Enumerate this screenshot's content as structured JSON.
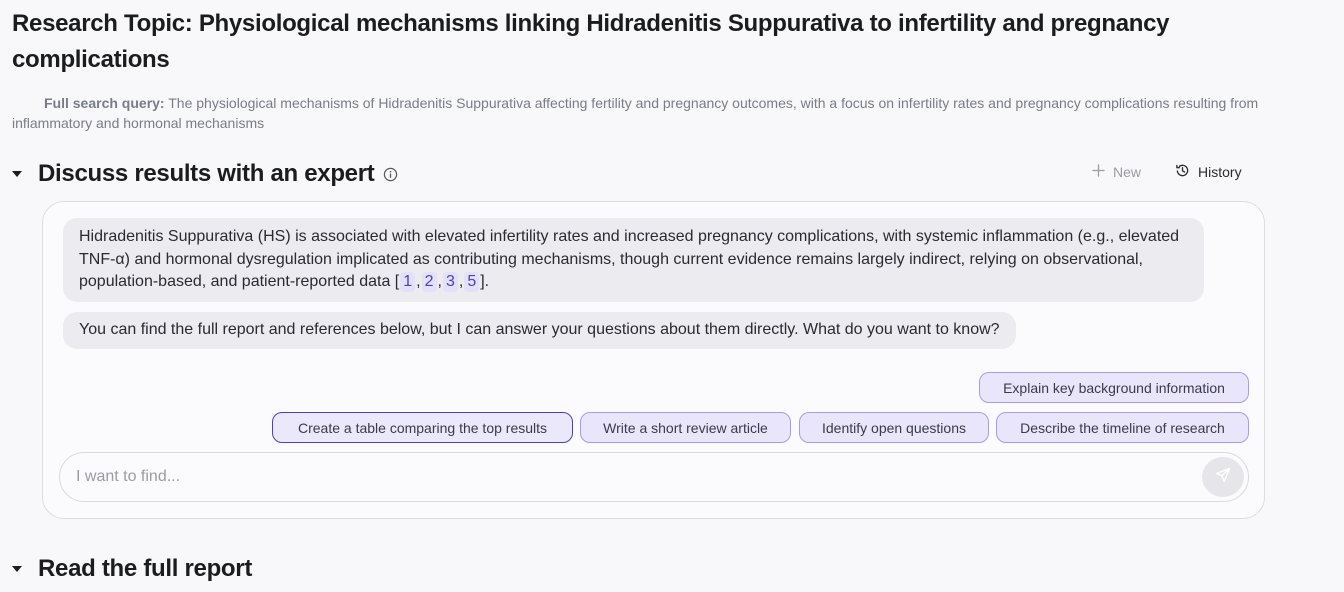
{
  "topic": {
    "title": "Research Topic: Physiological mechanisms linking Hidradenitis Suppurativa to infertility and pregnancy complications"
  },
  "query": {
    "label": "Full search query:",
    "text": " The physiological mechanisms of Hidradenitis Suppurativa affecting fertility and pregnancy outcomes, with a focus on infertility rates and pregnancy complications resulting from inflammatory and hormonal mechanisms"
  },
  "discuss": {
    "title": "Discuss results with an expert",
    "new_label": "New",
    "history_label": "History"
  },
  "messages": {
    "m1_text": "Hidradenitis Suppurativa (HS) is associated with elevated infertility rates and increased pregnancy complications, with systemic inflammation (e.g., elevated TNF-α) and hormonal dysregulation implicated as contributing mechanisms, though current evidence remains largely indirect, relying on observational, population-based, and patient-reported data [",
    "m1_citations": [
      "1",
      "2",
      "3",
      "5"
    ],
    "m1_end": "].",
    "m2_text": "You can find the full report and references below, but I can answer your questions about them directly. What do you want to know?"
  },
  "suggestions": {
    "s1": "Explain key background information",
    "s2": "Create a table comparing the top results",
    "s3": "Write a short review article",
    "s4": "Identify open questions",
    "s5": "Describe the timeline of research"
  },
  "input": {
    "placeholder": "I want to find..."
  },
  "report": {
    "title": "Read the full report"
  },
  "icons": {
    "caret": "caret-down-icon",
    "info": "info-icon",
    "plus": "plus-icon",
    "history": "history-icon",
    "send": "send-icon"
  }
}
